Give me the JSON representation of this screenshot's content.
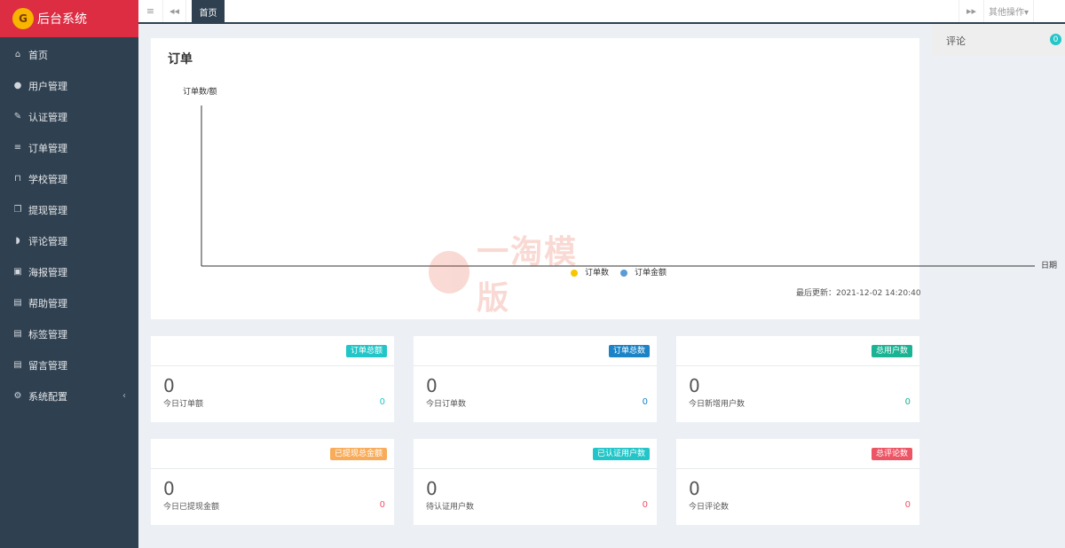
{
  "app": {
    "title": "后台系统",
    "logo_glyph": "G"
  },
  "sidebar": {
    "items": [
      {
        "label": "首页",
        "icon": "home-icon",
        "glyph": "⌂"
      },
      {
        "label": "用户管理",
        "icon": "user-icon",
        "glyph": "●"
      },
      {
        "label": "认证管理",
        "icon": "wrench-icon",
        "glyph": "✎"
      },
      {
        "label": "订单管理",
        "icon": "list-icon",
        "glyph": "≡"
      },
      {
        "label": "学校管理",
        "icon": "bank-icon",
        "glyph": "⊓"
      },
      {
        "label": "提现管理",
        "icon": "copy-icon",
        "glyph": "❐"
      },
      {
        "label": "评论管理",
        "icon": "comment-icon",
        "glyph": "◗"
      },
      {
        "label": "海报管理",
        "icon": "image-icon",
        "glyph": "▣"
      },
      {
        "label": "帮助管理",
        "icon": "file-icon",
        "glyph": "▤"
      },
      {
        "label": "标签管理",
        "icon": "file-icon",
        "glyph": "▤"
      },
      {
        "label": "留言管理",
        "icon": "file-icon",
        "glyph": "▤"
      },
      {
        "label": "系统配置",
        "icon": "gears-icon",
        "glyph": "⚙",
        "arrow": "‹"
      }
    ]
  },
  "topbar": {
    "menu_glyph": "≡",
    "back_glyph": "◂◂",
    "active_tab": "首页",
    "forward_glyph": "▸▸",
    "other_ops": "其他操作▾"
  },
  "right_panel": {
    "label": "评论",
    "count": "0"
  },
  "chart_card": {
    "title": "订单",
    "last_update": "最后更新：2021-12-02 14:20:40"
  },
  "chart_data": {
    "type": "line",
    "title": "",
    "ylabel": "订单数/额",
    "xlabel": "日期",
    "categories": [],
    "series": [
      {
        "name": "订单数",
        "color": "#f7c600",
        "values": []
      },
      {
        "name": "订单金额",
        "color": "#5b9bd5",
        "values": []
      }
    ],
    "legend": "bottom-center",
    "grid": false
  },
  "watermark": {
    "text": "一淘模版"
  },
  "stats": [
    {
      "tag": "订单总额",
      "big": "0",
      "sub": "今日订单额",
      "num": "0",
      "color": "teal"
    },
    {
      "tag": "订单总数",
      "big": "0",
      "sub": "今日订单数",
      "num": "0",
      "color": "blue"
    },
    {
      "tag": "总用户数",
      "big": "0",
      "sub": "今日新增用户数",
      "num": "0",
      "color": "green"
    },
    {
      "tag": "已提现总金额",
      "big": "0",
      "sub": "今日已提现金额",
      "num": "0",
      "color": "orange"
    },
    {
      "tag": "已认证用户数",
      "big": "0",
      "sub": "待认证用户数",
      "num": "0",
      "color": "teal"
    },
    {
      "tag": "总评论数",
      "big": "0",
      "sub": "今日评论数",
      "num": "0",
      "color": "red"
    }
  ]
}
